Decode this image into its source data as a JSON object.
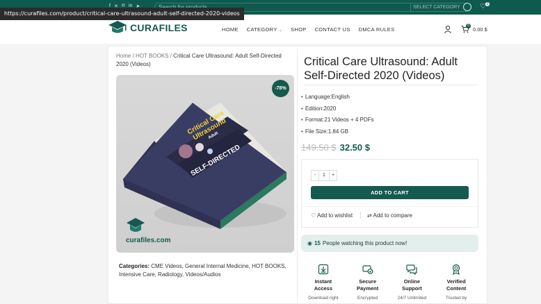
{
  "status_url": "https://curafiles.com/product/critical-care-ultrasound-adult-self-directed-2020-videos",
  "topbar": {
    "social_icons": [
      "facebook-icon",
      "x-icon",
      "pinterest-icon",
      "linkedin-icon",
      "telegram-icon"
    ],
    "search_placeholder": "Search for products",
    "search_category": "SELECT CATEGORY",
    "wishlist_count": "0"
  },
  "header": {
    "logo_text": "CURAFILES",
    "nav": [
      {
        "label": "HOME"
      },
      {
        "label": "CATEGORY",
        "caret": "⌄"
      },
      {
        "label": "SHOP"
      },
      {
        "label": "CONTACT US"
      },
      {
        "label": "DMCA RULES"
      }
    ],
    "cart_count": "0",
    "cart_total": "0.00 $"
  },
  "breadcrumb": {
    "home": "Home",
    "sep1": "/",
    "category": "HOT BOOKS",
    "sep2": "/",
    "current": "Critical Care Ultrasound: Adult Self-Directed 2020 (Videos)"
  },
  "product": {
    "discount_badge": "-78%",
    "cover_title_1": "Critical Care",
    "cover_title_2": "Ultrasound",
    "cover_sub": "Adult",
    "cover_band": "SELF-DIRECTED",
    "image_brand": "curafiles.com",
    "title": "Critical Care Ultrasound: Adult Self-Directed 2020 (Videos)",
    "specs": [
      "Language:English",
      "Edition:2020",
      "Format:21 Videos + 4 PDFs",
      "File Size:1.84 GB"
    ],
    "old_price": "149.50 $",
    "new_price": "32.50 $",
    "qty_minus": "-",
    "qty_value": "1",
    "qty_plus": "+",
    "add_to_cart": "ADD TO CART",
    "wishlist": "Add to wishlist",
    "compare": "Add to compare",
    "watching_count": "15",
    "watching_text": "People watching this product now!"
  },
  "categories": {
    "label": "Categories:",
    "items": [
      "CME Videos",
      "General Internal Medicine",
      "HOT BOOKS",
      "Intensive Care",
      "Radiology",
      "Videos/Audios"
    ]
  },
  "features": [
    {
      "icon": "download-icon",
      "title_1": "Instant",
      "title_2": "Access",
      "desc": "Download right"
    },
    {
      "icon": "secure-card-icon",
      "title_1": "Secure",
      "title_2": "Payment",
      "desc": "Encrypted"
    },
    {
      "icon": "chat-support-icon",
      "title_1": "Online",
      "title_2": "Support",
      "desc": "24/7 Unlimited"
    },
    {
      "icon": "verified-badge-icon",
      "title_1": "Verified",
      "title_2": "Content",
      "desc": "Trusted by"
    }
  ],
  "colors": {
    "brand": "#155a4e",
    "topbar": "#0f5a4f",
    "book_cover": "#3a3d63"
  }
}
